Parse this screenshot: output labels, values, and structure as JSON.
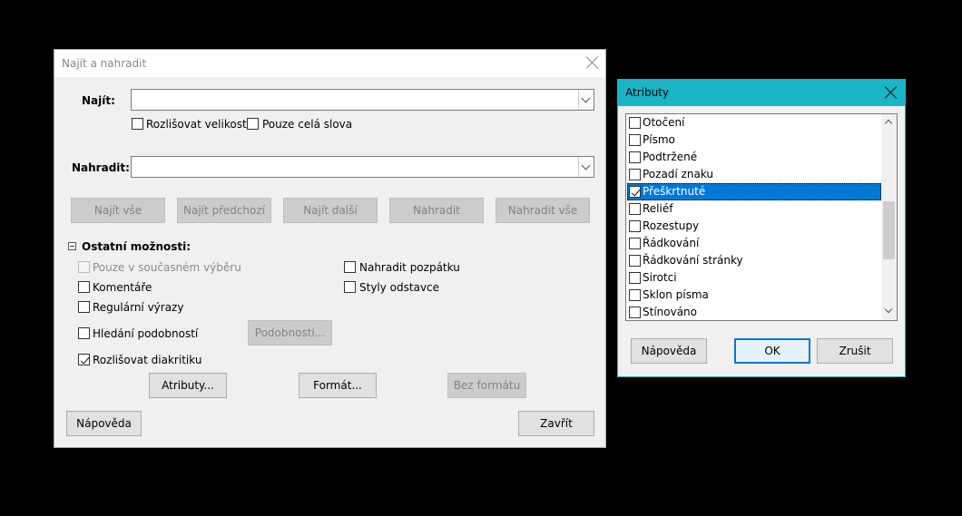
{
  "find_replace": {
    "title": "Najít a nahradit",
    "find_label": "Najít:",
    "find_value": "",
    "match_case": "Rozlišovat velikost",
    "whole_words": "Pouze celá slova",
    "replace_label": "Nahradit:",
    "replace_value": "",
    "buttons": {
      "find_all": "Najít vše",
      "find_previous": "Najít předchozí",
      "find_next": "Najít další",
      "replace": "Nahradit",
      "replace_all": "Nahradit vše"
    },
    "other_options": "Ostatní možnosti:",
    "current_selection_only": "Pouze v současném výběru",
    "comments": "Komentáře",
    "regex": "Regulární výrazy",
    "similarity_search": "Hledání podobností",
    "similarities_button": "Podobnosti...",
    "diacritics": "Rozlišovat diakritiku",
    "replace_backwards": "Nahradit pozpátku",
    "paragraph_styles": "Styly odstavce",
    "attributes_button": "Atributy...",
    "format_button": "Formát...",
    "no_format_button": "Bez formátu",
    "help_button": "Nápověda",
    "close_button": "Zavřít"
  },
  "attributes": {
    "title": "Atributy",
    "items": [
      {
        "label": "Otočení",
        "checked": false
      },
      {
        "label": "Písmo",
        "checked": false
      },
      {
        "label": "Podtržené",
        "checked": false
      },
      {
        "label": "Pozadí znaku",
        "checked": false
      },
      {
        "label": "Přeškrtnuté",
        "checked": true,
        "selected": true
      },
      {
        "label": "Reliéf",
        "checked": false
      },
      {
        "label": "Rozestupy",
        "checked": false
      },
      {
        "label": "Řádkování",
        "checked": false
      },
      {
        "label": "Řádkování stránky",
        "checked": false
      },
      {
        "label": "Sirotci",
        "checked": false
      },
      {
        "label": "Sklon písma",
        "checked": false
      },
      {
        "label": "Stínováno",
        "checked": false
      }
    ],
    "help_button": "Nápověda",
    "ok_button": "OK",
    "cancel_button": "Zrušit"
  },
  "colors": {
    "accent": "#0078d7",
    "attr_titlebar": "#19b4c6"
  }
}
